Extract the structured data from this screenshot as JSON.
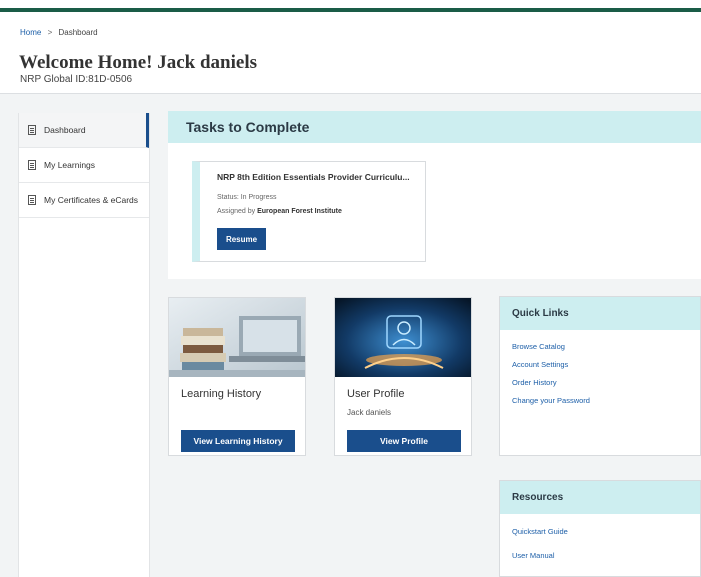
{
  "breadcrumb": {
    "home": "Home",
    "separator": ">",
    "current": "Dashboard"
  },
  "header": {
    "welcome": "Welcome Home! Jack daniels",
    "global_id": "NRP Global ID:81D-0506"
  },
  "sidebar": {
    "items": [
      {
        "label": "Dashboard",
        "active": true
      },
      {
        "label": "My Learnings",
        "active": false
      },
      {
        "label": "My Certificates & eCards",
        "active": false
      }
    ]
  },
  "tasks": {
    "heading": "Tasks to Complete",
    "card": {
      "title": "NRP 8th Edition Essentials Provider Curriculu...",
      "status": "Status: In Progress",
      "assigned_prefix": "Assigned by",
      "assigned_by": "European Forest Institute",
      "button": "Resume"
    }
  },
  "learning_history": {
    "title": "Learning History",
    "button": "View Learning History"
  },
  "user_profile": {
    "title": "User Profile",
    "name": "Jack daniels",
    "button": "View Profile"
  },
  "quick_links": {
    "heading": "Quick Links",
    "links": [
      "Browse Catalog",
      "Account Settings",
      "Order History",
      "Change your Password"
    ]
  },
  "resources": {
    "heading": "Resources",
    "links": [
      "Quickstart Guide",
      "User Manual"
    ]
  },
  "colors": {
    "brand": "#1a5c47",
    "button": "#1a4e8c",
    "section_header": "#cdeef0",
    "link": "#1d5fa8"
  }
}
